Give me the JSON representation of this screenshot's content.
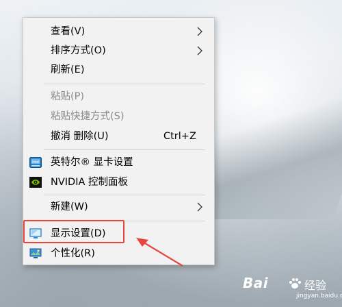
{
  "context_menu": {
    "items": [
      {
        "label": "查看(V)",
        "has_submenu": true,
        "enabled": true
      },
      {
        "label": "排序方式(O)",
        "has_submenu": true,
        "enabled": true
      },
      {
        "label": "刷新(E)",
        "enabled": true
      },
      {
        "label": "粘贴(P)",
        "enabled": false
      },
      {
        "label": "粘贴快捷方式(S)",
        "enabled": false
      },
      {
        "label": "撤消 删除(U)",
        "shortcut": "Ctrl+Z",
        "enabled": true
      },
      {
        "label": "英特尔® 显卡设置",
        "icon": "intel-graphics-icon",
        "enabled": true
      },
      {
        "label": "NVIDIA 控制面板",
        "icon": "nvidia-icon",
        "enabled": true
      },
      {
        "label": "新建(W)",
        "has_submenu": true,
        "enabled": true
      },
      {
        "label": "显示设置(D)",
        "icon": "display-settings-icon",
        "enabled": true,
        "highlighted": true
      },
      {
        "label": "个性化(R)",
        "icon": "personalize-icon",
        "enabled": true
      }
    ]
  },
  "annotation": {
    "highlight_color": "#e8453c"
  },
  "watermark": {
    "brand": "Bai",
    "brand2": "经验",
    "domain": "jingyan.baidu.com"
  },
  "colors": {
    "menu_bg": "#f2f2f2",
    "disabled_text": "#8a8a8a",
    "nvidia_green": "#76b900",
    "intel_blue": "#1e73be"
  }
}
